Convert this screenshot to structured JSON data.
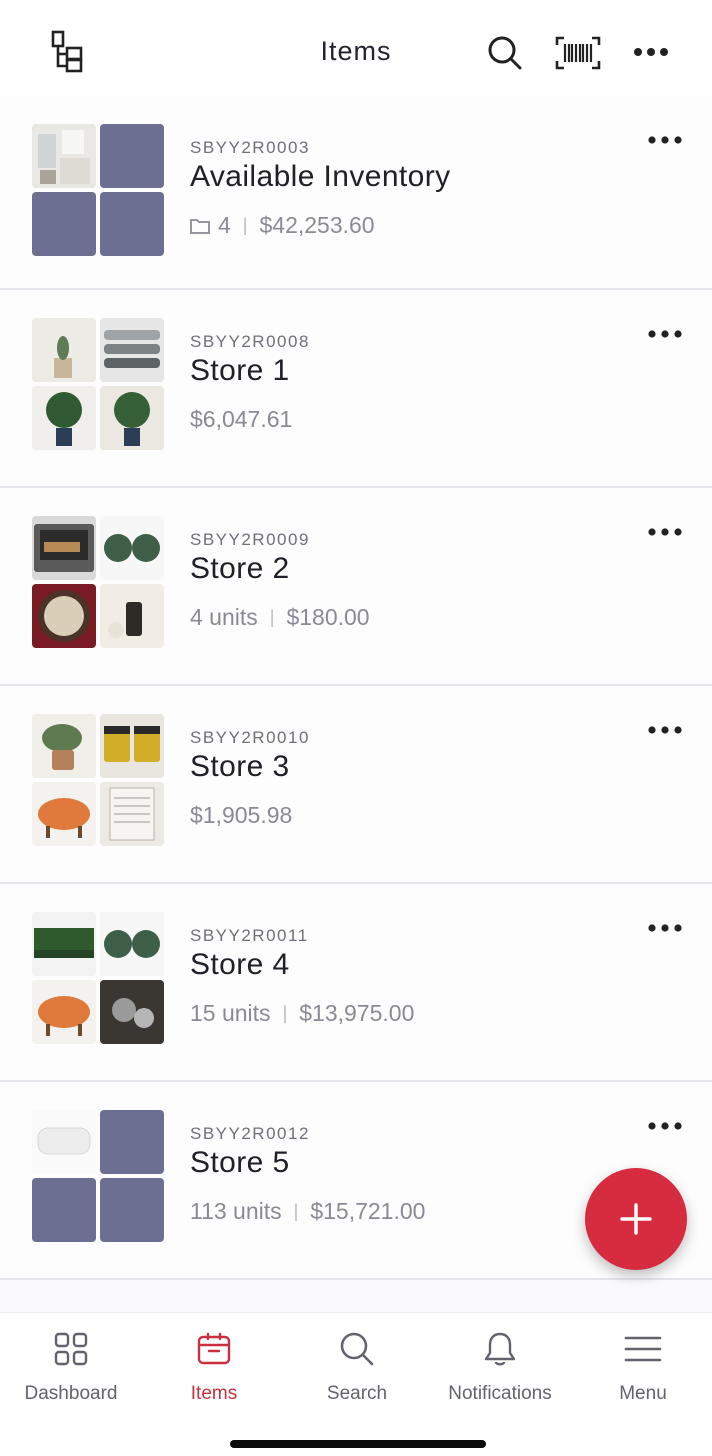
{
  "header": {
    "title": "Items",
    "icons": {
      "folders": "folder-tree-icon",
      "search": "search-icon",
      "barcode": "barcode-scan-icon",
      "more": "more-horizontal-icon"
    }
  },
  "items": [
    {
      "sku": "SBYY2R0003",
      "name": "Available Inventory",
      "folders": "4",
      "units": "",
      "value": "$42,253.60"
    },
    {
      "sku": "SBYY2R0008",
      "name": "Store 1",
      "folders": "",
      "units": "",
      "value": "$6,047.61"
    },
    {
      "sku": "SBYY2R0009",
      "name": "Store 2",
      "folders": "",
      "units": "4 units",
      "value": "$180.00"
    },
    {
      "sku": "SBYY2R0010",
      "name": "Store 3",
      "folders": "",
      "units": "",
      "value": "$1,905.98"
    },
    {
      "sku": "SBYY2R0011",
      "name": "Store 4",
      "folders": "",
      "units": "15 units",
      "value": "$13,975.00"
    },
    {
      "sku": "SBYY2R0012",
      "name": "Store 5",
      "folders": "",
      "units": "113 units",
      "value": "$15,721.00"
    }
  ],
  "fab": {
    "icon": "plus-icon"
  },
  "nav": [
    {
      "label": "Dashboard",
      "icon": "dashboard-grid-icon"
    },
    {
      "label": "Items",
      "icon": "box-icon"
    },
    {
      "label": "Search",
      "icon": "search-icon"
    },
    {
      "label": "Notifications",
      "icon": "bell-icon"
    },
    {
      "label": "Menu",
      "icon": "menu-icon"
    }
  ],
  "colors": {
    "accent": "#d72c3f",
    "active_nav": "#c83040",
    "placeholder_tile": "#6d6f92"
  }
}
